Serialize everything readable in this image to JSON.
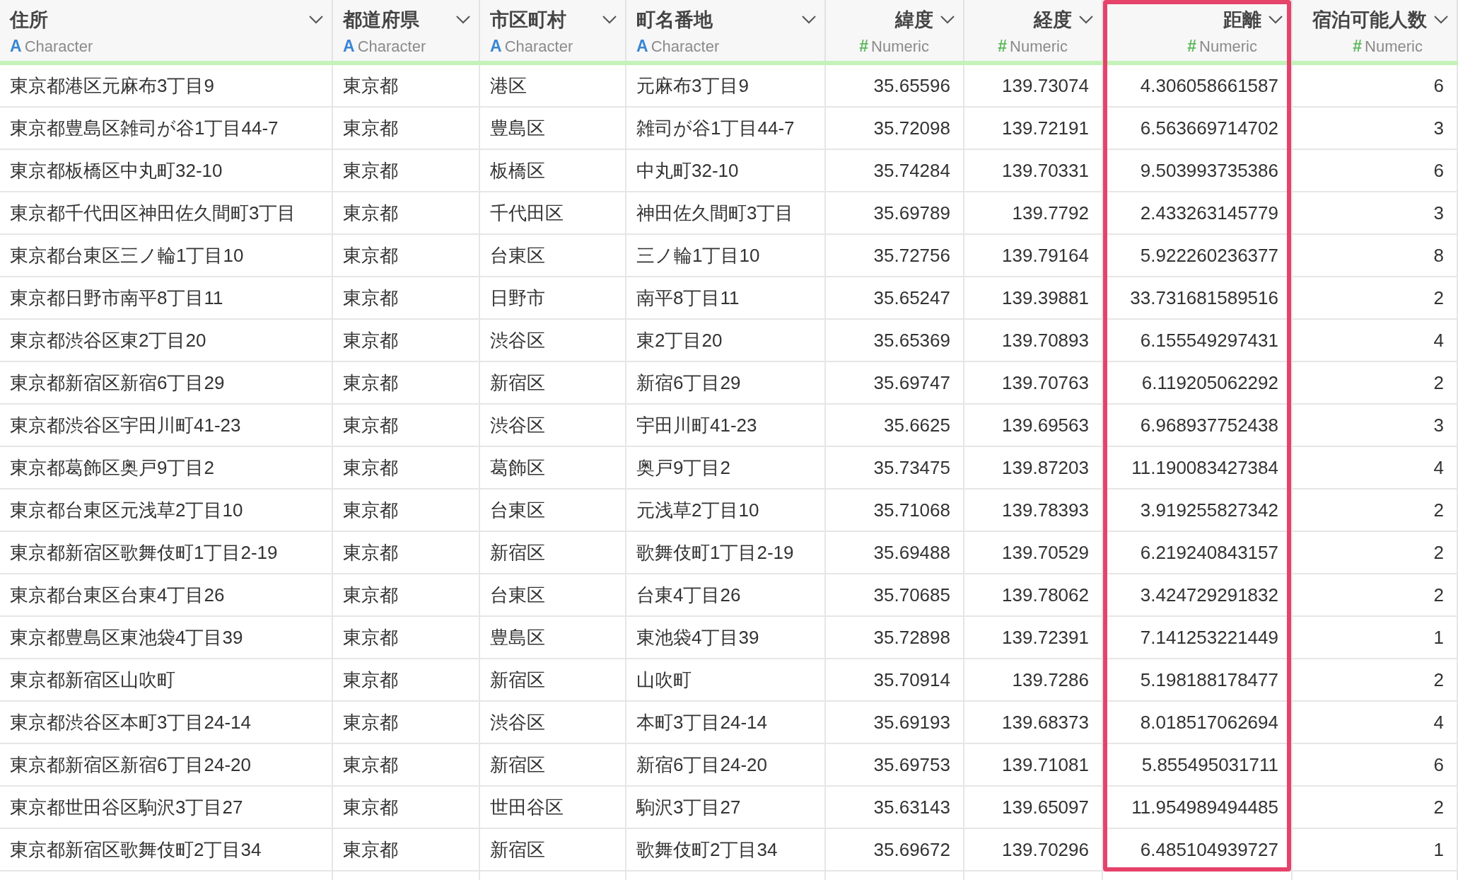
{
  "table": {
    "columns": [
      {
        "name": "住所",
        "type_icon": "A",
        "type": "Character",
        "kind": "text",
        "highlighted": false
      },
      {
        "name": "都道府県",
        "type_icon": "A",
        "type": "Character",
        "kind": "text",
        "highlighted": false
      },
      {
        "name": "市区町村",
        "type_icon": "A",
        "type": "Character",
        "kind": "text",
        "highlighted": false
      },
      {
        "name": "町名番地",
        "type_icon": "A",
        "type": "Character",
        "kind": "text",
        "highlighted": false
      },
      {
        "name": "緯度",
        "type_icon": "#",
        "type": "Numeric",
        "kind": "numeric",
        "highlighted": false
      },
      {
        "name": "経度",
        "type_icon": "#",
        "type": "Numeric",
        "kind": "numeric",
        "highlighted": false
      },
      {
        "name": "距離",
        "type_icon": "#",
        "type": "Numeric",
        "kind": "numeric",
        "highlighted": true
      },
      {
        "name": "宿泊可能人数",
        "type_icon": "#",
        "type": "Numeric",
        "kind": "numeric",
        "highlighted": false
      }
    ],
    "rows": [
      [
        "東京都港区元麻布3丁目9",
        "東京都",
        "港区",
        "元麻布3丁目9",
        "35.65596",
        "139.73074",
        "4.306058661587",
        "6"
      ],
      [
        "東京都豊島区雑司が谷1丁目44-7",
        "東京都",
        "豊島区",
        "雑司が谷1丁目44-7",
        "35.72098",
        "139.72191",
        "6.563669714702",
        "3"
      ],
      [
        "東京都板橋区中丸町32-10",
        "東京都",
        "板橋区",
        "中丸町32-10",
        "35.74284",
        "139.70331",
        "9.503993735386",
        "6"
      ],
      [
        "東京都千代田区神田佐久間町3丁目",
        "東京都",
        "千代田区",
        "神田佐久間町3丁目",
        "35.69789",
        "139.7792",
        "2.433263145779",
        "3"
      ],
      [
        "東京都台東区三ノ輪1丁目10",
        "東京都",
        "台東区",
        "三ノ輪1丁目10",
        "35.72756",
        "139.79164",
        "5.922260236377",
        "8"
      ],
      [
        "東京都日野市南平8丁目11",
        "東京都",
        "日野市",
        "南平8丁目11",
        "35.65247",
        "139.39881",
        "33.731681589516",
        "2"
      ],
      [
        "東京都渋谷区東2丁目20",
        "東京都",
        "渋谷区",
        "東2丁目20",
        "35.65369",
        "139.70893",
        "6.155549297431",
        "4"
      ],
      [
        "東京都新宿区新宿6丁目29",
        "東京都",
        "新宿区",
        "新宿6丁目29",
        "35.69747",
        "139.70763",
        "6.119205062292",
        "2"
      ],
      [
        "東京都渋谷区宇田川町41-23",
        "東京都",
        "渋谷区",
        "宇田川町41-23",
        "35.6625",
        "139.69563",
        "6.968937752438",
        "3"
      ],
      [
        "東京都葛飾区奥戸9丁目2",
        "東京都",
        "葛飾区",
        "奥戸9丁目2",
        "35.73475",
        "139.87203",
        "11.190083427384",
        "4"
      ],
      [
        "東京都台東区元浅草2丁目10",
        "東京都",
        "台東区",
        "元浅草2丁目10",
        "35.71068",
        "139.78393",
        "3.919255827342",
        "2"
      ],
      [
        "東京都新宿区歌舞伎町1丁目2-19",
        "東京都",
        "新宿区",
        "歌舞伎町1丁目2-19",
        "35.69488",
        "139.70529",
        "6.219240843157",
        "2"
      ],
      [
        "東京都台東区台東4丁目26",
        "東京都",
        "台東区",
        "台東4丁目26",
        "35.70685",
        "139.78062",
        "3.424729291832",
        "2"
      ],
      [
        "東京都豊島区東池袋4丁目39",
        "東京都",
        "豊島区",
        "東池袋4丁目39",
        "35.72898",
        "139.72391",
        "7.141253221449",
        "1"
      ],
      [
        "東京都新宿区山吹町",
        "東京都",
        "新宿区",
        "山吹町",
        "35.70914",
        "139.7286",
        "5.198188178477",
        "2"
      ],
      [
        "東京都渋谷区本町3丁目24-14",
        "東京都",
        "渋谷区",
        "本町3丁目24-14",
        "35.69193",
        "139.68373",
        "8.018517062694",
        "4"
      ],
      [
        "東京都新宿区新宿6丁目24-20",
        "東京都",
        "新宿区",
        "新宿6丁目24-20",
        "35.69753",
        "139.71081",
        "5.855495031711",
        "6"
      ],
      [
        "東京都世田谷区駒沢3丁目27",
        "東京都",
        "世田谷区",
        "駒沢3丁目27",
        "35.63143",
        "139.65097",
        "11.954989494485",
        "2"
      ],
      [
        "東京都新宿区歌舞伎町2丁目34",
        "東京都",
        "新宿区",
        "歌舞伎町2丁目34",
        "35.69672",
        "139.70296",
        "6.485104939727",
        "1"
      ]
    ]
  }
}
